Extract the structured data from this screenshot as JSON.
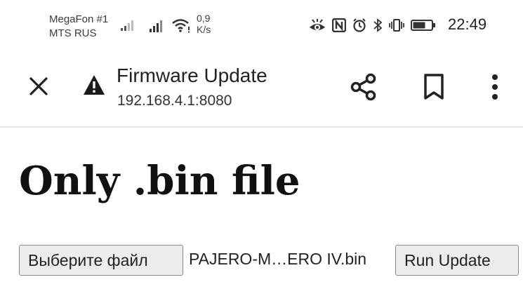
{
  "status_bar": {
    "carrier_1": "MegaFon #1",
    "carrier_2": "MTS RUS",
    "net_speed_value": "0,9",
    "net_speed_unit": "K/s",
    "time": "22:49",
    "icons": [
      "signal-icon",
      "signal-icon",
      "wifi-icon",
      "eye-icon",
      "nfc-icon",
      "alarm-icon",
      "bluetooth-icon",
      "vibrate-icon",
      "battery-icon"
    ]
  },
  "toolbar": {
    "title": "Firmware Update",
    "url": "192.168.4.1:8080",
    "icons": [
      "close-icon",
      "warning-icon",
      "share-icon",
      "bookmark-icon",
      "more-vert-icon"
    ]
  },
  "page": {
    "heading": "Only .bin file",
    "choose_file_label": "Выберите файл",
    "file_name": "PAJERO-M…ERO IV.bin",
    "run_update_label": "Run Update"
  }
}
